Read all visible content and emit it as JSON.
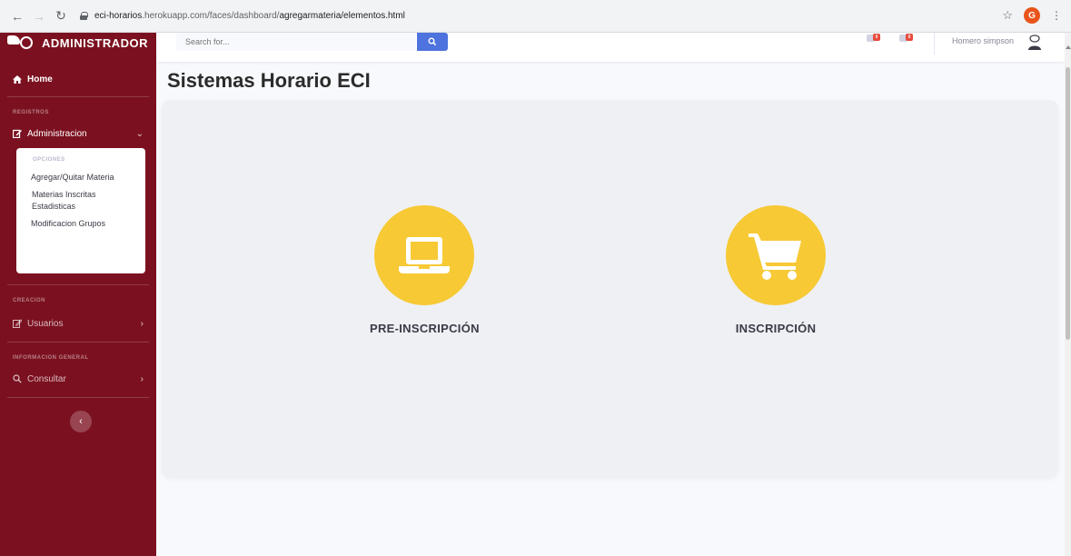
{
  "browser": {
    "url_host": "eci-horarios",
    "url_path": ".herokuapp.com/faces/dashboard/",
    "url_tail": "agregarmateria/elementos.html",
    "profile_initial": "G"
  },
  "sidebar": {
    "brand": "ADMINISTRADOR",
    "home_label": "Home",
    "section_registros": "REGISTROS",
    "administracion_label": "Administracion",
    "submenu": {
      "header": "OPCIONES",
      "items": [
        {
          "label": "Agregar/Quitar Materia"
        },
        {
          "label": "Materias Inscritas"
        },
        {
          "label": "Estadisticas"
        },
        {
          "label": "Modificacion Grupos"
        }
      ]
    },
    "section_creacion": "CREACION",
    "usuarios_label": "Usuarios",
    "section_info": "INFORMACION GENERAL",
    "consultar_label": "Consultar"
  },
  "topbar": {
    "search_placeholder": "Search for...",
    "alerts_badge": "0",
    "messages_badge": "0",
    "user_name": "Homero simpson"
  },
  "main": {
    "title": "Sistemas Horario ECI",
    "options": [
      {
        "label": "PRE-INSCRIPCIÓN",
        "icon": "laptop-icon"
      },
      {
        "label": "INSCRIPCIÓN",
        "icon": "shopping-cart-icon"
      }
    ]
  },
  "colors": {
    "sidebar": "#7b1120",
    "accent": "#f7c934",
    "search_button": "#4e73df"
  }
}
